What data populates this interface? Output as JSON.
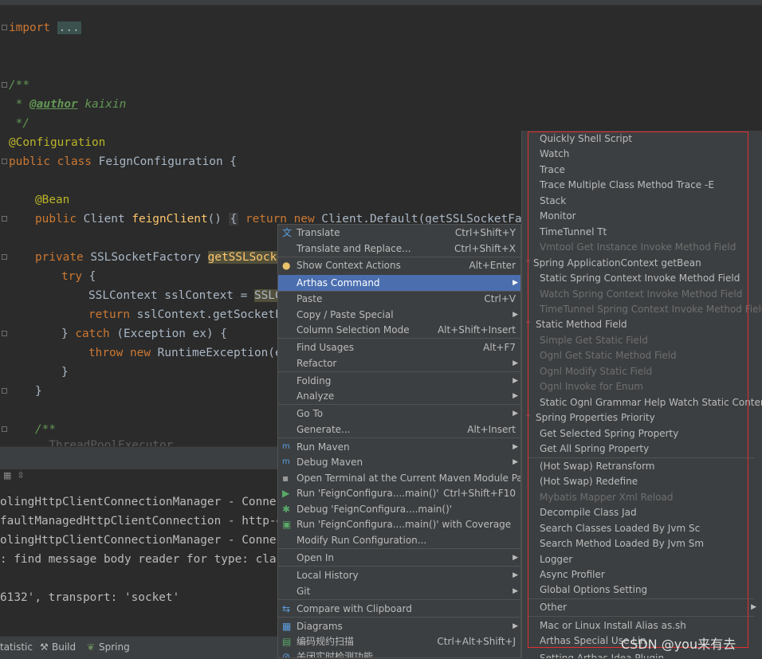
{
  "editor": {
    "lines": {
      "import_kw": "import",
      "import_fold": "...",
      "doc_open": "/**",
      "author_prefix": " * ",
      "author_tag": "@author",
      "author_name": " kaixin",
      "doc_close": " */",
      "config_ann": "@Configuration",
      "class_public": "public",
      "class_kw": "class",
      "class_name": "FeignConfiguration {",
      "bean_ann": "@Bean",
      "fc_public": "public",
      "fc_type": "Client",
      "fc_name": "feignClient",
      "fc_parens": "()",
      "fc_brace": "{",
      "fc_return": "return",
      "fc_new": "new",
      "fc_rest": "Client.Default(getSSLSocketFactor",
      "ssl_private": "private",
      "ssl_type": "SSLSocketFactory",
      "ssl_name": "getSSLSocket",
      "try_kw": "try",
      "try_brace": " {",
      "ctx_decl": "SSLContext sslContext = ",
      "ctx_hl": "SSLCo",
      "ret_kw": "return",
      "ret_rest": " sslContext.getSocketFa",
      "catch_close": "} ",
      "catch_kw": "catch",
      "catch_rest": " (Exception ex) {",
      "throw_kw": "throw",
      "throw_new": "new",
      "throw_rest": " RuntimeException(ex",
      "brace1": "}",
      "brace2": "}",
      "doc2_open": "/**",
      "partial": "  ThreadPoolExecutor"
    }
  },
  "console": {
    "lines": [
      "olingHttpClientConnectionManager - Connecti",
      "faultManagedHttpClientConnection - http-out",
      "olingHttpClientConnectionManager - Connecti",
      ": find message body reader for type: class ",
      "",
      "6132', transport: 'socket'"
    ]
  },
  "statusbar": {
    "statistic": "tatistic",
    "build": "Build",
    "spring": "Spring"
  },
  "context_menu": {
    "items": [
      {
        "label": "Translate",
        "shortcut": "Ctrl+Shift+Y"
      },
      {
        "label": "Translate and Replace...",
        "shortcut": "Ctrl+Shift+X"
      },
      {
        "label": "Show Context Actions",
        "shortcut": "Alt+Enter"
      },
      {
        "label": "Arthas Command",
        "shortcut": ""
      },
      {
        "label": "Paste",
        "shortcut": "Ctrl+V"
      },
      {
        "label": "Copy / Paste Special",
        "shortcut": ""
      },
      {
        "label": "Column Selection Mode",
        "shortcut": "Alt+Shift+Insert"
      },
      {
        "label": "Find Usages",
        "shortcut": "Alt+F7"
      },
      {
        "label": "Refactor",
        "shortcut": ""
      },
      {
        "label": "Folding",
        "shortcut": ""
      },
      {
        "label": "Analyze",
        "shortcut": ""
      },
      {
        "label": "Go To",
        "shortcut": ""
      },
      {
        "label": "Generate...",
        "shortcut": "Alt+Insert"
      },
      {
        "label": "Run Maven",
        "shortcut": ""
      },
      {
        "label": "Debug Maven",
        "shortcut": ""
      },
      {
        "label": "Open Terminal at the Current Maven Module Path",
        "shortcut": ""
      },
      {
        "label": "Run 'FeignConfigura....main()'",
        "shortcut": "Ctrl+Shift+F10"
      },
      {
        "label": "Debug 'FeignConfigura....main()'",
        "shortcut": ""
      },
      {
        "label": "Run 'FeignConfigura....main()' with Coverage",
        "shortcut": ""
      },
      {
        "label": "Modify Run Configuration...",
        "shortcut": ""
      },
      {
        "label": "Open In",
        "shortcut": ""
      },
      {
        "label": "Local History",
        "shortcut": ""
      },
      {
        "label": "Git",
        "shortcut": ""
      },
      {
        "label": "Compare with Clipboard",
        "shortcut": ""
      },
      {
        "label": "Diagrams",
        "shortcut": ""
      },
      {
        "label": "编码规约扫描",
        "shortcut": "Ctrl+Alt+Shift+J"
      },
      {
        "label": "关闭实时检测功能",
        "shortcut": ""
      }
    ]
  },
  "submenu": {
    "items": [
      {
        "label": "Quickly Shell Script"
      },
      {
        "label": "Watch"
      },
      {
        "label": "Trace"
      },
      {
        "label": "Trace Multiple Class Method Trace -E"
      },
      {
        "label": "Stack"
      },
      {
        "label": "Monitor"
      },
      {
        "label": "TimeTunnel Tt"
      },
      {
        "label": "Vmtool Get Instance Invoke Method Field"
      },
      {
        "label": "Spring ApplicationContext getBean"
      },
      {
        "label": "Static Spring Context Invoke  Method Field"
      },
      {
        "label": "Watch Spring Context Invoke Method Field"
      },
      {
        "label": "TimeTunnel Spring Context Invoke Method Field"
      },
      {
        "label": "Static Method Field"
      },
      {
        "label": "Simple Get Static Field"
      },
      {
        "label": "Ognl Get Static Method Field"
      },
      {
        "label": "Ognl Modify Static Field"
      },
      {
        "label": "Ognl Invoke for Enum"
      },
      {
        "label": "Static Ognl Grammar Help Watch Static Content"
      },
      {
        "label": "Spring Properties Priority"
      },
      {
        "label": "Get Selected Spring Property"
      },
      {
        "label": "Get All Spring Property"
      },
      {
        "label": "(Hot Swap) Retransform"
      },
      {
        "label": "(Hot Swap) Redefine"
      },
      {
        "label": "Mybatis Mapper Xml Reload"
      },
      {
        "label": "Decompile Class Jad"
      },
      {
        "label": "Search Classes Loaded By Jvm Sc"
      },
      {
        "label": "Search Method Loaded By Jvm Sm"
      },
      {
        "label": "Logger"
      },
      {
        "label": "Async Profiler"
      },
      {
        "label": "Global Options Setting"
      },
      {
        "label": "Other"
      },
      {
        "label": "Mac or Linux Install Alias as.sh"
      },
      {
        "label": "Arthas Special Use Lin"
      },
      {
        "label": "Setting Arthas Idea Plugin"
      }
    ]
  },
  "watermark": "CSDN @you来有去",
  "colors": {
    "selection": "#4b6eaf",
    "highlight_box": "#e03030",
    "menu_bg": "#3c3f41",
    "editor_bg": "#2b2b2b"
  }
}
